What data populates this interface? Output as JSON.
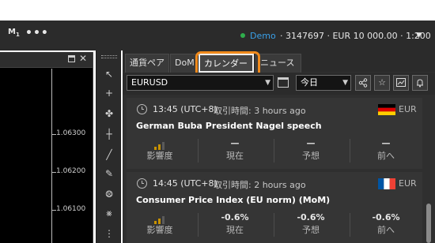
{
  "topbar": {
    "workspace_main": "M",
    "workspace_sub": "1",
    "more": "•••",
    "mode": "Demo",
    "account": "· 3147697 · EUR 10 000.00 · 1:200",
    "chevron": "▼"
  },
  "chart": {
    "close": "✕",
    "prices": [
      "1.06300",
      "1.06200",
      "1.06100"
    ]
  },
  "toolbar": {
    "items": [
      {
        "icon": "cursor-icon",
        "glyph": "↖"
      },
      {
        "icon": "crosshair-icon",
        "glyph": "+"
      },
      {
        "icon": "multi-crosshair-icon",
        "glyph": "✤"
      },
      {
        "icon": "point-crosshair-icon",
        "glyph": "┼"
      },
      {
        "icon": "line-tool-icon",
        "glyph": "╱"
      },
      {
        "icon": "pen-tool-icon",
        "glyph": "✎"
      },
      {
        "icon": "fibonacci-tool-icon",
        "glyph": "⨷"
      },
      {
        "icon": "pattern-tool-icon",
        "glyph": "⨳"
      },
      {
        "icon": "more-tools-icon",
        "glyph": "⋮"
      }
    ]
  },
  "tabs": [
    "通貨ペア",
    "DoM",
    "カレンダー",
    "ニュース"
  ],
  "filters": {
    "symbol": "EURUSD",
    "period": "今日",
    "chevron": "▼"
  },
  "events": [
    {
      "time": "13:45 (UTC+8)",
      "remain": "取引時間: 3 hours ago",
      "currency": "EUR",
      "flag": "germany",
      "title": "German Buba President Nagel speech",
      "impact": "2",
      "current": "—",
      "forecast": "—",
      "previous": "—"
    },
    {
      "time": "14:45 (UTC+8)",
      "remain": "取引時間: 2 hours ago",
      "currency": "EUR",
      "flag": "france",
      "title": "Consumer Price Index (EU norm) (MoM)",
      "impact": "2",
      "current": "-0.6%",
      "forecast": "-0.6%",
      "previous": "-0.6%"
    }
  ],
  "columns": {
    "impact": "影響度",
    "current": "現在",
    "forecast": "予想",
    "previous": "前へ"
  },
  "colors": {
    "highlight": "#f08a1c",
    "impact_on": "#c79200",
    "demo_link": "#3aa0e8",
    "status_dot": "#2fae4c"
  }
}
